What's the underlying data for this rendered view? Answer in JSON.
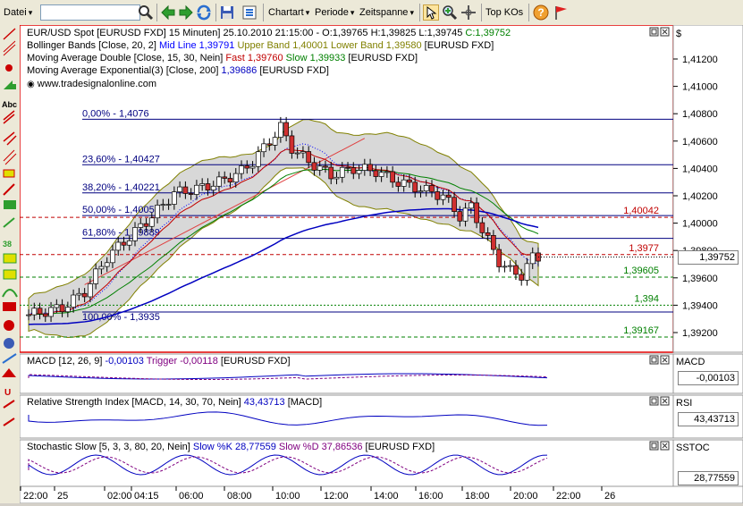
{
  "toolbar": {
    "file_menu": "Datei",
    "search_value": "",
    "menus": [
      "Chartart",
      "Periode",
      "Zeitspanne"
    ],
    "top_kos": "Top KOs"
  },
  "main_chart": {
    "title": "EUR/USD Spot [EURUSD FXD]  15 Minuten] 25.10.2010 21:15:00 - O:1,39765 H:1,39825 L:1,39745 C:1,39752",
    "title_main": "EUR/USD Spot [EURUSD FXD]  15 Minuten] 25.10.2010 21:15:00 - O:1,39765 H:1,39825 L:1,39745 ",
    "title_close": "C:1,39752",
    "bollinger": {
      "label": "Bollinger Bands [Close, 20, 2]",
      "mid": "Mid Line 1,39791",
      "upper": "Upper Band 1,40001",
      "lower": "Lower Band 1,39580",
      "sym": "[EURUSD FXD]"
    },
    "mad": {
      "label": "Moving Average Double [Close, 15, 30, Nein]",
      "fast": "Fast 1,39760",
      "slow": "Slow 1,39933",
      "sym": "[EURUSD FXD]"
    },
    "mae": {
      "label": "Moving Average Exponential(3) [Close, 200]",
      "val": "1,39686",
      "sym": "[EURUSD FXD]"
    },
    "website": "www.tradesignalonline.com",
    "fib_labels": [
      "0,00% - 1,4076",
      "23,60% - 1,40427",
      "38,20% - 1,40221",
      "50,00% - 1,40055",
      "61,80% - 1,39889",
      "100,00% - 1,3935"
    ],
    "line_labels": [
      "1,40042",
      "1,3977",
      "1,39605",
      "1,394",
      "1,39167"
    ],
    "price_axis": [
      "1,41200",
      "1,41000",
      "1,40800",
      "1,40600",
      "1,40400",
      "1,40200",
      "1,40000",
      "1,39800",
      "1,39600",
      "1,39400",
      "1,39200"
    ],
    "currency_symbol": "$",
    "last_price": "1,39752"
  },
  "macd": {
    "label": "MACD [12, 26, 9]",
    "val": "-0,00103",
    "trigger": "Trigger -0,00118",
    "sym": "[EURUSD FXD]",
    "side_label": "MACD",
    "side_value": "-0,00103"
  },
  "rsi": {
    "label": "Relative Strength Index [MACD, 14, 30, 70, Nein]",
    "val": "43,43713",
    "sym": "[MACD]",
    "side_label": "RSI",
    "side_value": "43,43713"
  },
  "stoch": {
    "label": "Stochastic Slow [5, 3, 3, 80, 20, Nein]",
    "k": "Slow %K 28,77559",
    "d": "Slow %D 37,86536",
    "sym": "[EURUSD FXD]",
    "side_label": "SSTOC",
    "side_value": "28,77559"
  },
  "time_axis": [
    "22:00",
    "25",
    "02:00",
    "04:15",
    "06:00",
    "08:00",
    "10:00",
    "12:00",
    "14:00",
    "16:00",
    "18:00",
    "20:00",
    "22:00",
    "26"
  ],
  "colors": {
    "upper_band": "#808000",
    "lower_band": "#808000",
    "mid_line": "#0000ff",
    "fast": "#c00000",
    "slow": "#008000",
    "mae": "#0000c0",
    "close": "#008000",
    "frame": "#e00000"
  }
}
